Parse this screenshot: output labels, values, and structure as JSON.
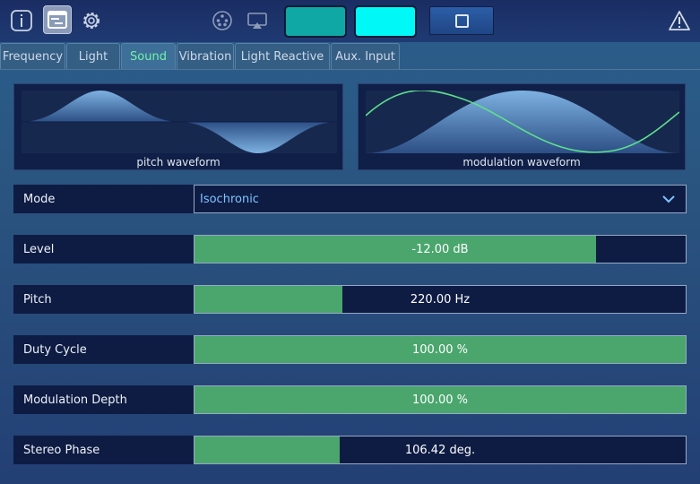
{
  "toolbar": {
    "icons": [
      "info-icon",
      "panel-icon",
      "gear-icon",
      "dmx-icon",
      "airplay-icon",
      "alert-icon"
    ],
    "swatch_colors": [
      "#0fa8a4",
      "#00f8f6"
    ],
    "stop_icon": "stop-square-icon"
  },
  "tabs": [
    {
      "label": "Frequency"
    },
    {
      "label": "Light"
    },
    {
      "label": "Sound",
      "active": true
    },
    {
      "label": "Vibration"
    },
    {
      "label": "Light Reactive"
    },
    {
      "label": "Aux. Input"
    }
  ],
  "waveforms": {
    "pitch_caption": "pitch waveform",
    "modulation_caption": "modulation waveform"
  },
  "controls": {
    "mode": {
      "label": "Mode",
      "value": "Isochronic"
    },
    "level": {
      "label": "Level",
      "value": "-12.00 dB",
      "fill": 0.818
    },
    "pitch": {
      "label": "Pitch",
      "value": "220.00 Hz",
      "fill": 0.302
    },
    "duty_cycle": {
      "label": "Duty Cycle",
      "value": "100.00 %",
      "fill": 1.0
    },
    "modulation_depth": {
      "label": "Modulation Depth",
      "value": "100.00 %",
      "fill": 1.0
    },
    "stereo_phase": {
      "label": "Stereo Phase",
      "value": "106.42 deg.",
      "fill": 0.296
    }
  },
  "colors": {
    "accent_green": "#4aa66d",
    "active_tab_text": "#6ff5a6",
    "dropdown_text": "#7fc3ff"
  }
}
